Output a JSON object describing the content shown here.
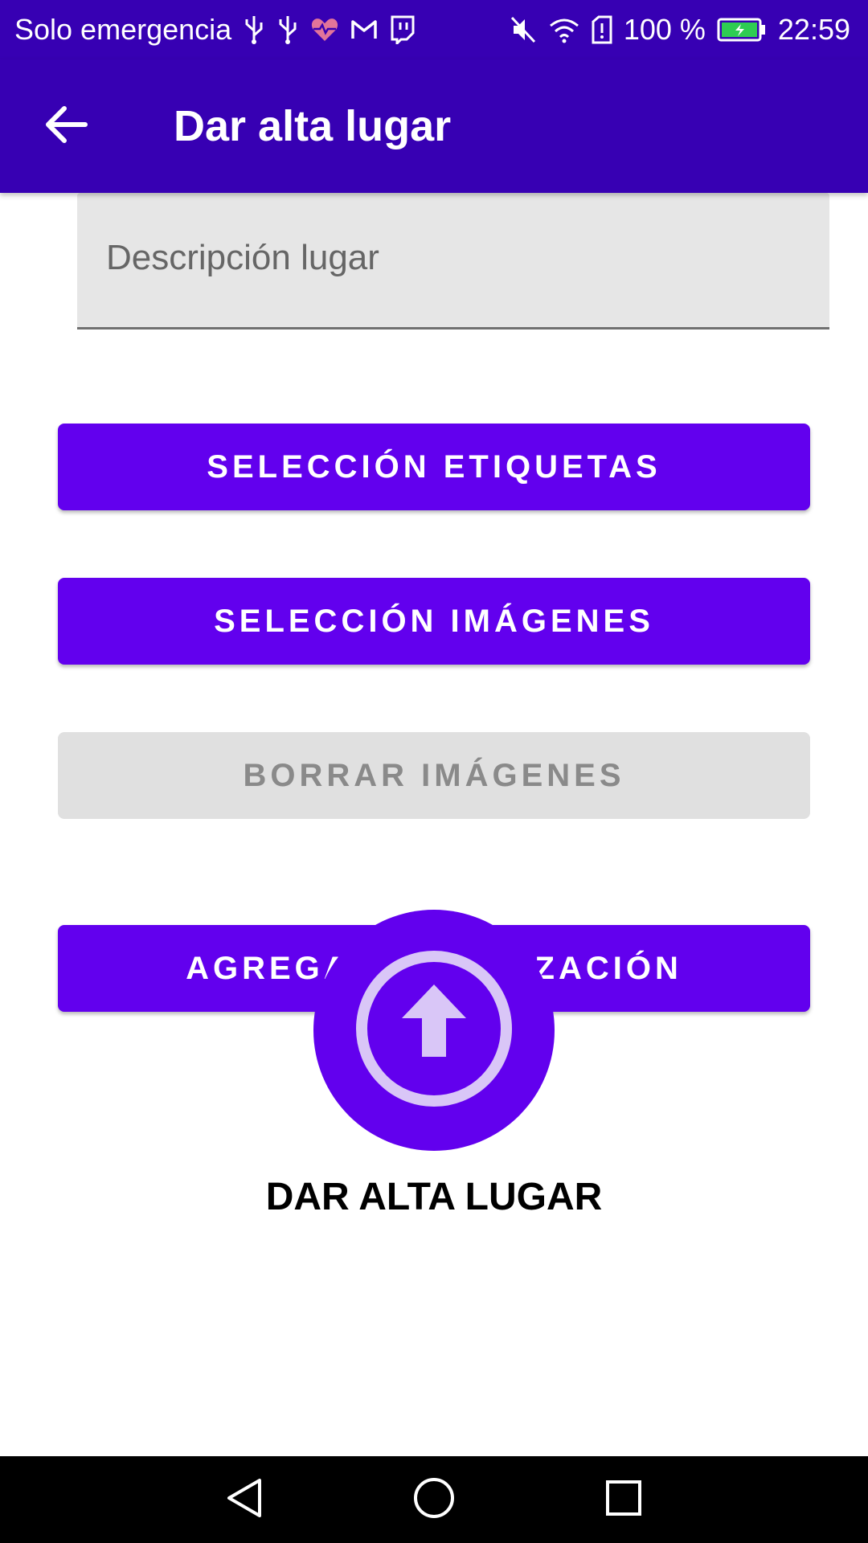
{
  "status_bar": {
    "carrier": "Solo emergencia",
    "battery": "100 %",
    "time": "22:59",
    "icons_left": [
      "usb-icon",
      "usb-icon",
      "health-heart-icon",
      "gmail-icon",
      "twitch-icon"
    ],
    "icons_right": [
      "mute-icon",
      "wifi-icon",
      "sim-alert-icon",
      "battery-icon"
    ]
  },
  "app_bar": {
    "title": "Dar alta lugar",
    "back_icon": "arrow-back-icon"
  },
  "form": {
    "description_placeholder": "Descripción lugar",
    "buttons": {
      "tags": "SELECCIÓN ETIQUETAS",
      "images": "SELECCIÓN IMÁGENES",
      "delete_images": "BORRAR IMÁGENES",
      "location": "AGREGAR LOCALIZACIÓN"
    },
    "submit_label": "DAR ALTA LUGAR",
    "submit_icon": "upload-circle-icon"
  },
  "nav_bar": {
    "back": "nav-back-icon",
    "home": "nav-home-icon",
    "recents": "nav-recents-icon"
  },
  "colors": {
    "primary_dark": "#3700b3",
    "primary": "#6200ee",
    "disabled_bg": "#e0e0e0",
    "disabled_text": "#8a8a8a"
  }
}
